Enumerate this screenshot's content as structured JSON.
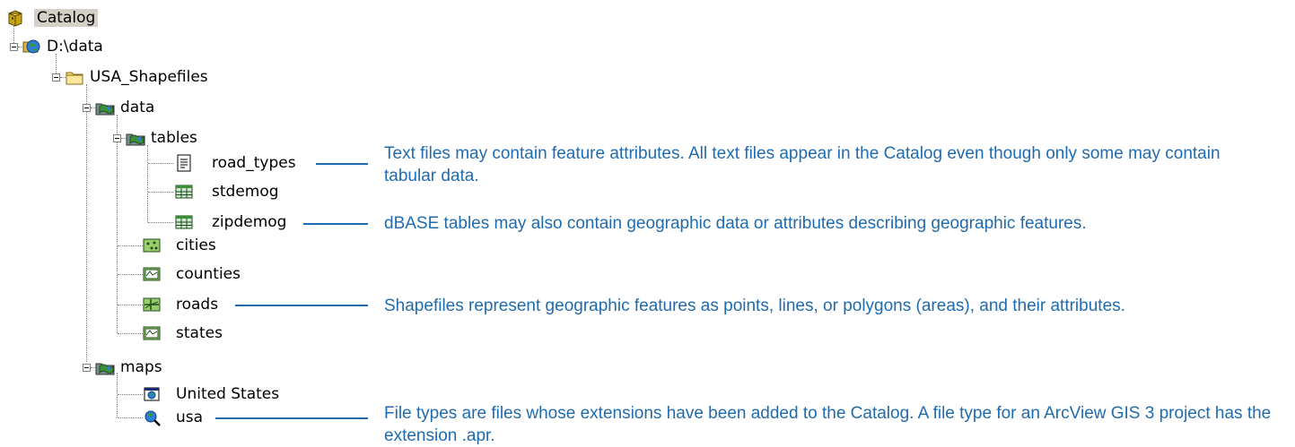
{
  "tree": {
    "root": "Catalog",
    "drive": "D:\\data",
    "folder": "USA_Shapefiles",
    "data": "data",
    "tables": "tables",
    "road_types": "road_types",
    "stdemog": "stdemog",
    "zipdemog": "zipdemog",
    "cities": "cities",
    "counties": "counties",
    "roads": "roads",
    "states": "states",
    "maps": "maps",
    "united_states": "United States",
    "usa": "usa"
  },
  "notes": {
    "text_files": "Text files may contain feature attributes. All text files appear in the Catalog even though only some may contain tabular data.",
    "dbase": "dBASE tables may also contain geographic data or attributes describing geographic features.",
    "shapefiles": "Shapefiles represent geographic features as points, lines, or polygons (areas), and their attributes.",
    "file_types": "File types are files whose extensions have been added to the Catalog. A file type for an ArcView GIS 3 project has the extension .apr."
  },
  "colors": {
    "annotation": "#1f6bb0",
    "selection": "#d4d0c8"
  }
}
